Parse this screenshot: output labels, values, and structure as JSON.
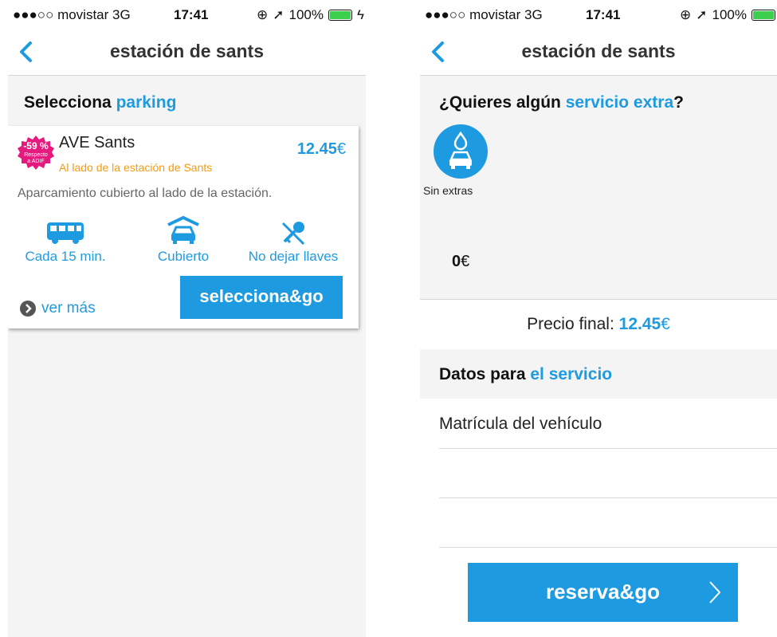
{
  "status": {
    "carrier": "●●●○○ movistar  3G",
    "time": "17:41",
    "battery": "100%"
  },
  "nav": {
    "title": "estación de sants"
  },
  "left": {
    "section_title_a": "Selecciona ",
    "section_title_b": "parking",
    "card": {
      "badge_percent": "-59 %",
      "badge_line1": "Respecto",
      "badge_line2": "a ADIF",
      "name": "AVE Sants",
      "subtitle": "Al lado de la estación de Sants",
      "price": "12.45",
      "currency": "€",
      "description": "Aparcamiento cubierto al lado de la estación.",
      "amenities": [
        {
          "label": "Cada 15 min.",
          "icon": "bus-icon"
        },
        {
          "label": "Cubierto",
          "icon": "covered-parking-icon"
        },
        {
          "label": "No dejar llaves",
          "icon": "no-keys-icon"
        }
      ],
      "more_label": "ver más",
      "select_button": "selecciona&go"
    }
  },
  "right": {
    "extras_title_a": "¿Quieres algún ",
    "extras_title_b": "servicio extra",
    "extras_title_c": "?",
    "extra_option": {
      "label": "Sin extras",
      "icon": "car-wash-icon"
    },
    "extras_price": "0",
    "currency": "€",
    "final_label": "Precio final: ",
    "final_price": "12.45",
    "data_title_a": "Datos para ",
    "data_title_b": "el servicio",
    "plate_placeholder": "Matrícula del vehículo",
    "reserve_button": "reserva&go"
  },
  "colors": {
    "accent": "#1e9be0",
    "badge": "#e5197e",
    "subtitle": "#f39c12",
    "panel": "#f4f4f4"
  }
}
